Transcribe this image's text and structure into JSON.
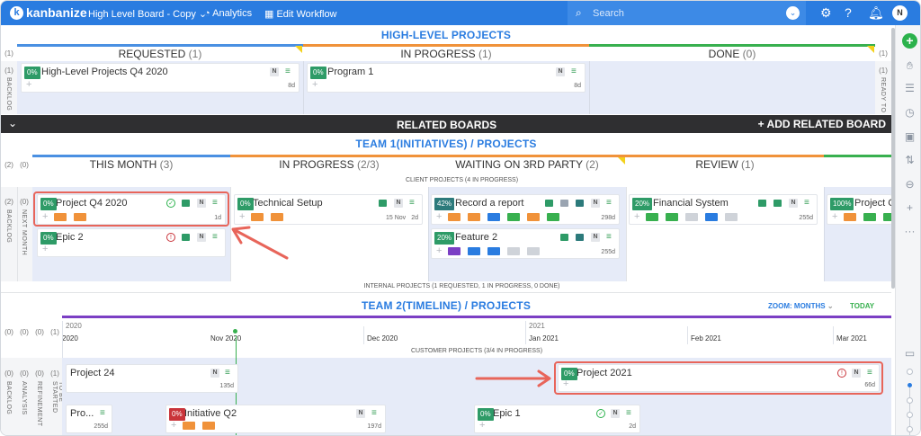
{
  "topbar": {
    "logo": "kanbanize",
    "board_selector": "High Level Board - Copy",
    "analytics": "Analytics",
    "edit_workflow": "Edit Workflow",
    "search_placeholder": "Search",
    "avatar_initial": "N"
  },
  "high_level": {
    "title": "HIGH-LEVEL PROJECTS",
    "backlog_label": "BACKLOG",
    "backlog_count": "(1)",
    "backlog_count_top": "(1)",
    "ready_label": "READY TO",
    "ready_count": "(1)",
    "ready_count_top": "(1)",
    "columns": [
      {
        "name": "REQUESTED",
        "count": "(1)"
      },
      {
        "name": "IN PROGRESS",
        "count": "(1)"
      },
      {
        "name": "DONE",
        "count": "(0)"
      }
    ],
    "cards": [
      {
        "pct": "0%",
        "title": "High-Level Projects Q4 2020",
        "badge": "N",
        "days": "8d"
      },
      {
        "pct": "0%",
        "title": "Program 1",
        "badge": "N",
        "days": "8d"
      }
    ]
  },
  "related": {
    "title": "RELATED BOARDS",
    "add": "+ ADD RELATED BOARD"
  },
  "team1": {
    "title": "TEAM 1(INITIATIVES) / PROJECTS",
    "counts_top": [
      "(2)",
      "(0)"
    ],
    "lane_counts": [
      "(2)",
      "(0)"
    ],
    "lane_labels": [
      "BACKLOG",
      "NEXT MONTH"
    ],
    "columns": [
      {
        "name": "THIS MONTH",
        "count": "(3)"
      },
      {
        "name": "IN PROGRESS",
        "count": "(2/3)"
      },
      {
        "name": "WAITING ON 3RD PARTY",
        "count": "(2)"
      },
      {
        "name": "REVIEW",
        "count": "(1)"
      }
    ],
    "client_header": "CLIENT PROJECTS (4 IN PROGRESS)",
    "internal_header": "INTERNAL PROJECTS (1 REQUESTED, 1 IN PROGRESS, 0 DONE)",
    "cards": [
      {
        "pct": "0%",
        "title": "Project Q4 2020",
        "badge": "N",
        "days": "1d"
      },
      {
        "pct": "0%",
        "title": "Epic 2",
        "badge": "N"
      },
      {
        "pct": "0%",
        "title": "Technical Setup",
        "badge": "N",
        "date": "15 Nov",
        "days": "2d"
      },
      {
        "pct": "42%",
        "title": "Record a report",
        "badge": "N",
        "days": "298d"
      },
      {
        "pct": "20%",
        "title": "Feature 2",
        "badge": "N",
        "days": "255d"
      },
      {
        "pct": "20%",
        "title": "Financial System",
        "badge": "N",
        "days": "255d"
      },
      {
        "pct": "100%",
        "title": "Project C",
        "badge": "N"
      }
    ]
  },
  "team2": {
    "title": "TEAM 2(TIMELINE) / PROJECTS",
    "zoom_label": "ZOOM:",
    "zoom_value": "MONTHS",
    "today": "TODAY",
    "top_counts": [
      "(0)",
      "(0)",
      "(0)",
      "(1)"
    ],
    "lane_counts": [
      "(0)",
      "(0)",
      "(0)",
      "(1)"
    ],
    "lane_labels": [
      "BACKLOG",
      "ANALYSIS",
      "REFINEMENT",
      "TO BE STARTED"
    ],
    "years": [
      "2020",
      "2021"
    ],
    "months": [
      "2020",
      "Nov 2020",
      "Dec 2020",
      "Jan 2021",
      "Feb 2021",
      "Mar 2021"
    ],
    "customer_header": "CUSTOMER PROJECTS (3/4 IN PROGRESS)",
    "cards": [
      {
        "pct": "",
        "title": "Project 24",
        "badge": "N",
        "days": "135d"
      },
      {
        "pct": "0%",
        "title": "Project 2021",
        "badge": "N",
        "days": "66d"
      },
      {
        "pct": "",
        "title": "Pro...",
        "days": "255d"
      },
      {
        "pct": "0%",
        "title": "Initiative Q2",
        "badge": "N",
        "days": "197d"
      },
      {
        "pct": "0%",
        "title": "Epic 1",
        "badge": "N",
        "days": "2d"
      }
    ]
  },
  "colors": {
    "brand_blue": "#2a7ce0",
    "progress_green": "#2e9b67",
    "highlight_red": "#e8655a",
    "timeline_purple": "#7b3fc4"
  }
}
